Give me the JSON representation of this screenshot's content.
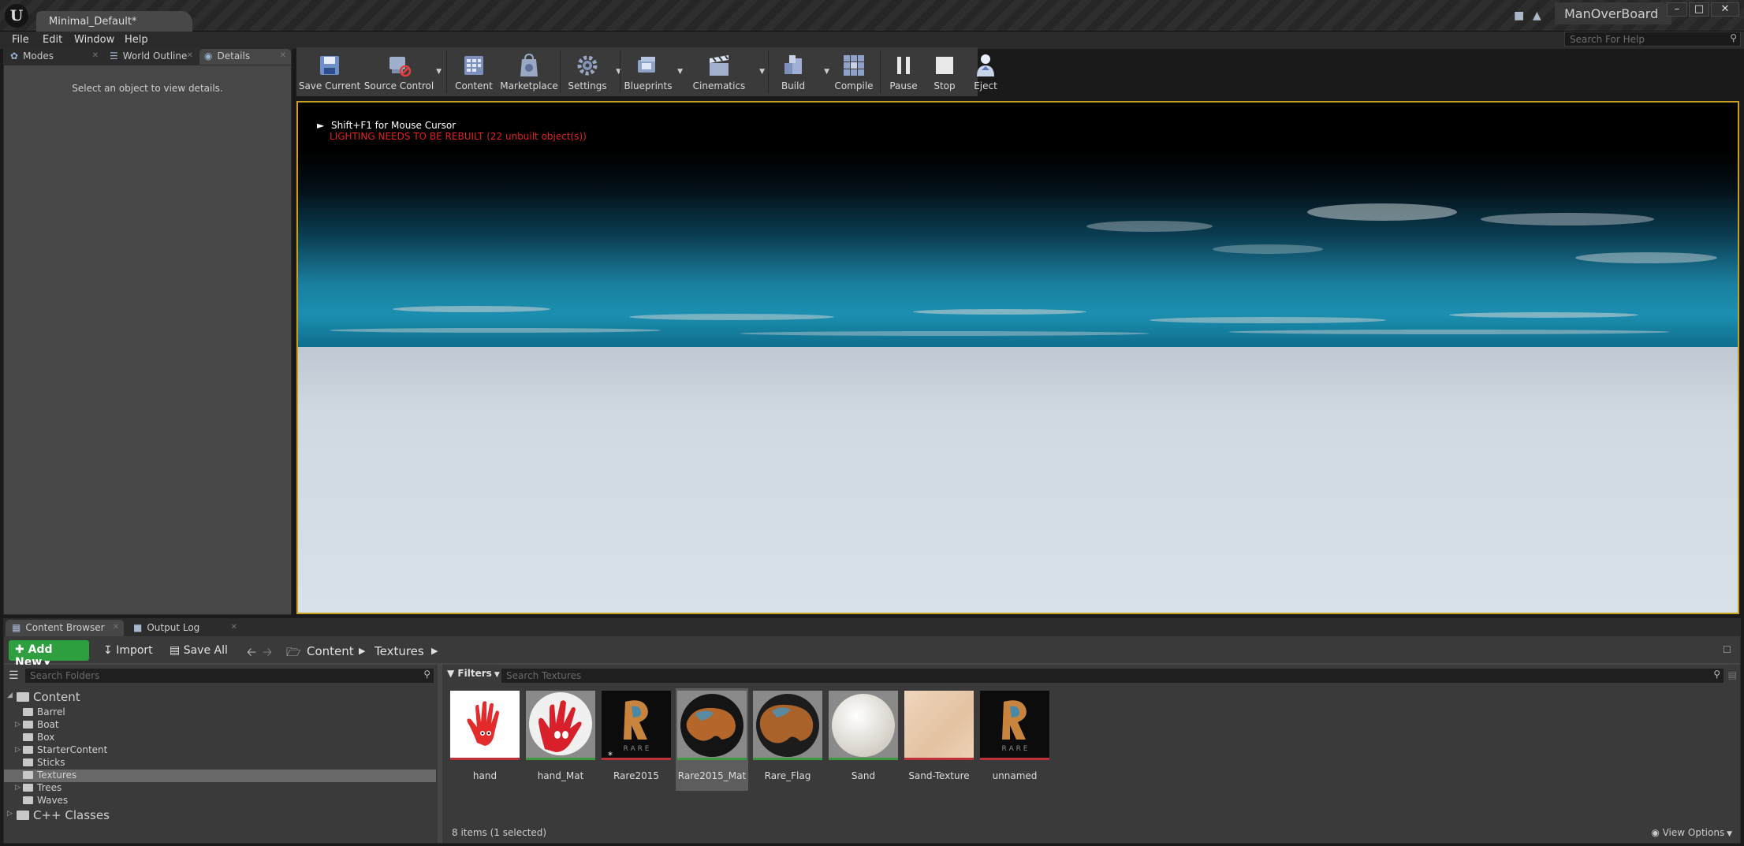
{
  "window": {
    "document_tab": "Minimal_Default*",
    "project_name": "ManOverBoard",
    "logo_icon": "unreal-engine-logo",
    "controls": [
      "–",
      "□",
      "✕"
    ]
  },
  "menu": {
    "items": [
      "File",
      "Edit",
      "Window",
      "Help"
    ],
    "help_search_placeholder": "Search For Help"
  },
  "left_panel": {
    "tabs": [
      {
        "label": "Modes",
        "icon": "modes-icon"
      },
      {
        "label": "World Outline",
        "icon": "world-outline-icon"
      },
      {
        "label": "Details",
        "icon": "details-icon"
      }
    ],
    "message": "Select an object to view details."
  },
  "toolbar": {
    "buttons": [
      {
        "label": "Save Current",
        "icon": "save-icon"
      },
      {
        "label": "Source Control",
        "icon": "source-control-icon"
      },
      {
        "label": "Content",
        "icon": "content-icon"
      },
      {
        "label": "Marketplace",
        "icon": "marketplace-icon"
      },
      {
        "label": "Settings",
        "icon": "settings-icon"
      },
      {
        "label": "Blueprints",
        "icon": "blueprints-icon"
      },
      {
        "label": "Cinematics",
        "icon": "cinematics-icon"
      },
      {
        "label": "Build",
        "icon": "build-icon"
      },
      {
        "label": "Compile",
        "icon": "compile-icon"
      },
      {
        "label": "Pause",
        "icon": "pause-icon"
      },
      {
        "label": "Stop",
        "icon": "stop-icon"
      },
      {
        "label": "Eject",
        "icon": "eject-icon"
      }
    ]
  },
  "viewport": {
    "hint": "Shift+F1 for Mouse Cursor",
    "warning": "LIGHTING NEEDS TO BE REBUILT (22 unbuilt object(s))",
    "warning_color": "#e02020",
    "water_color": "#1b8fb0",
    "floor_color": "#d3dbe3"
  },
  "bottom": {
    "tabs": [
      {
        "label": "Content Browser",
        "icon": "content-browser-icon"
      },
      {
        "label": "Output Log",
        "icon": "output-log-icon"
      }
    ],
    "add_new": "Add New",
    "import": "Import",
    "save_all": "Save All",
    "breadcrumb": [
      "Content",
      "Textures"
    ],
    "folder_search_placeholder": "Search Folders",
    "asset_search_placeholder": "Search Textures",
    "filters": "Filters",
    "tree": [
      {
        "label": "Content"
      },
      {
        "label": "Barrel"
      },
      {
        "label": "Boat"
      },
      {
        "label": "Box"
      },
      {
        "label": "StarterContent"
      },
      {
        "label": "Sticks"
      },
      {
        "label": "Textures"
      },
      {
        "label": "Trees"
      },
      {
        "label": "Waves"
      },
      {
        "label": "C++ Classes"
      }
    ],
    "assets": [
      {
        "name": "hand",
        "type_color": "#c0303a"
      },
      {
        "name": "hand_Mat",
        "type_color": "#3c9a3c"
      },
      {
        "name": "Rare2015",
        "type_color": "#c0303a"
      },
      {
        "name": "Rare2015_Mat",
        "type_color": "#3c9a3c"
      },
      {
        "name": "Rare_Flag",
        "type_color": "#3c9a3c"
      },
      {
        "name": "Sand",
        "type_color": "#3c9a3c"
      },
      {
        "name": "Sand-Texture",
        "type_color": "#c0303a"
      },
      {
        "name": "unnamed",
        "type_color": "#c0303a"
      }
    ],
    "status": "8 items (1 selected)",
    "view_options": "View Options"
  }
}
